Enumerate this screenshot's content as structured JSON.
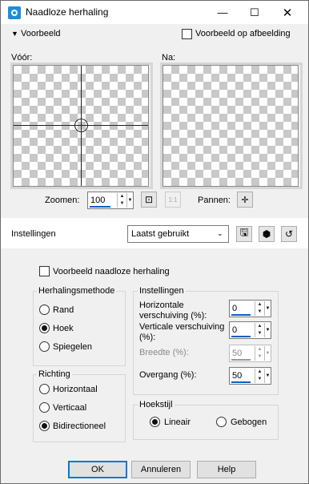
{
  "window": {
    "title": "Naadloze herhaling"
  },
  "preview_section": {
    "toggle_label": "Voorbeeld",
    "preview_on_image_label": "Voorbeeld op afbeelding"
  },
  "before_label": "Vóór:",
  "after_label": "Na:",
  "zoom": {
    "label": "Zoomen:",
    "value": "100"
  },
  "pan_label": "Pannen:",
  "settings_bar": {
    "label": "Instellingen",
    "preset": "Laatst gebruikt"
  },
  "seamless_preview_label": "Voorbeeld naadloze herhaling",
  "repeat_method": {
    "title": "Herhalingsmethode",
    "options": [
      "Rand",
      "Hoek",
      "Spiegelen"
    ],
    "selected": "Hoek"
  },
  "direction": {
    "title": "Richting",
    "options": [
      "Horizontaal",
      "Verticaal",
      "Bidirectioneel"
    ],
    "selected": "Bidirectioneel"
  },
  "settings_group": {
    "title": "Instellingen",
    "horizontal_label": "Horizontale verschuiving (%):",
    "horizontal_value": "0",
    "vertical_label": "Verticale verschuiving (%):",
    "vertical_value": "0",
    "width_label": "Breedte (%):",
    "width_value": "50",
    "transition_label": "Overgang (%):",
    "transition_value": "50"
  },
  "corner_style": {
    "title": "Hoekstijl",
    "options": [
      "Lineair",
      "Gebogen"
    ],
    "selected": "Lineair"
  },
  "buttons": {
    "ok": "OK",
    "cancel": "Annuleren",
    "help": "Help"
  }
}
